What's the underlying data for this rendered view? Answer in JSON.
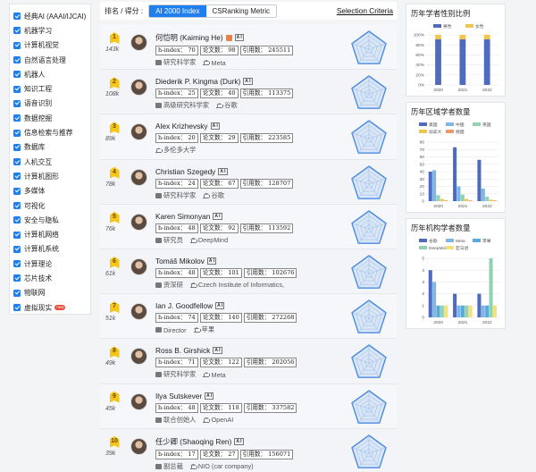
{
  "sidebar": {
    "items": [
      {
        "label": "经典AI (AAAI/IJCAI)"
      },
      {
        "label": "机器学习"
      },
      {
        "label": "计算机视觉"
      },
      {
        "label": "自然语言处理"
      },
      {
        "label": "机器人"
      },
      {
        "label": "知识工程"
      },
      {
        "label": "语音识别"
      },
      {
        "label": "数据挖掘"
      },
      {
        "label": "信息检索与推荐"
      },
      {
        "label": "数据库"
      },
      {
        "label": "人机交互"
      },
      {
        "label": "计算机图形"
      },
      {
        "label": "多媒体"
      },
      {
        "label": "可视化"
      },
      {
        "label": "安全与隐私"
      },
      {
        "label": "计算机网络"
      },
      {
        "label": "计算机系统"
      },
      {
        "label": "计算理论"
      },
      {
        "label": "芯片技术"
      },
      {
        "label": "物联网"
      },
      {
        "label": "虚拟现实",
        "badge": "new"
      }
    ]
  },
  "topbar": {
    "rank_label": "排名 / 得分 :",
    "tabs": [
      "AI 2000 Index",
      "CSRanking Metric"
    ],
    "criteria": "Selection Criteria"
  },
  "scholars": [
    {
      "rank": "1",
      "score": "143k",
      "name": "何恺明 (Kaiming He)",
      "badge_square": true,
      "ai_tag": "A I",
      "hindex": "h-index： 70",
      "papers": "论文数： 98",
      "citations": "引用数： 245511",
      "role": "研究科学家",
      "org": "Meta"
    },
    {
      "rank": "2",
      "score": "108k",
      "name": "Diederik P. Kingma (Durk)",
      "ai_tag": "A I",
      "hindex": "h-index： 25",
      "papers": "论文数： 40",
      "citations": "引用数： 113375",
      "role": "高级研究科学家",
      "org": "谷歌"
    },
    {
      "rank": "3",
      "score": "89k",
      "name": "Alex Krizhevsky",
      "ai_tag": "A I",
      "hindex": "h-index： 20",
      "papers": "论文数： 29",
      "citations": "引用数： 223585",
      "role": "",
      "org": "多伦多大学"
    },
    {
      "rank": "4",
      "score": "78k",
      "name": "Christian Szegedy",
      "ai_tag": "A I",
      "hindex": "h-index： 24",
      "papers": "论文数： 67",
      "citations": "引用数： 128707",
      "role": "研究科学家",
      "org": "谷歌"
    },
    {
      "rank": "5",
      "score": "76k",
      "name": "Karen Simonyan",
      "ai_tag": "A I",
      "hindex": "h-index： 48",
      "papers": "论文数： 92",
      "citations": "引用数： 113592",
      "role": "研究员",
      "org": "DeepMind"
    },
    {
      "rank": "6",
      "score": "61k",
      "name": "Tomáš Mikolov",
      "ai_tag": "A I",
      "hindex": "h-index： 48",
      "papers": "论文数： 101",
      "citations": "引用数： 102676",
      "role": "资深研",
      "org": "Czech Institute of Informatics,"
    },
    {
      "rank": "7",
      "score": "51k",
      "name": "Ian J. Goodfellow",
      "ai_tag": "A I",
      "hindex": "h-index： 74",
      "papers": "论文数： 140",
      "citations": "引用数： 272268",
      "role": "Director",
      "org": "苹果"
    },
    {
      "rank": "8",
      "score": "49k",
      "name": "Ross B. Girshick",
      "ai_tag": "A I",
      "hindex": "h-index： 71",
      "papers": "论文数： 122",
      "citations": "引用数： 202056",
      "role": "研究科学家",
      "org": "Meta"
    },
    {
      "rank": "9",
      "score": "45k",
      "name": "Ilya Sutskever",
      "ai_tag": "A I",
      "hindex": "h-index： 48",
      "papers": "论文数： 118",
      "citations": "引用数： 337582",
      "role": "联合创始人",
      "org": "OpenAI"
    },
    {
      "rank": "10",
      "score": "39k",
      "name": "任少卿 (Shaoqing Ren)",
      "ai_tag": "A I",
      "hindex": "h-index： 17",
      "papers": "论文数： 27",
      "citations": "引用数： 156071",
      "role": "副总裁",
      "org": "NIO (car company)"
    }
  ],
  "chart_data": [
    {
      "type": "bar",
      "title": "历年学者性别比例",
      "categories": [
        "2020",
        "2021",
        "2022"
      ],
      "ylim": [
        0,
        1
      ],
      "ticks": [
        "100%",
        "80%",
        "60%",
        "40%",
        "20%",
        "0%"
      ],
      "series": [
        {
          "name": "男性",
          "color": "#4e6bbf",
          "values": [
            0.91,
            0.91,
            0.91
          ]
        },
        {
          "name": "女性",
          "color": "#f3c64b",
          "values": [
            0.09,
            0.09,
            0.09
          ]
        }
      ]
    },
    {
      "type": "bar",
      "title": "历年区域学者数量",
      "categories": [
        "2020",
        "2021",
        "2022"
      ],
      "ylim": [
        0,
        80
      ],
      "ticks": [
        "80",
        "70",
        "60",
        "50",
        "40",
        "30",
        "20",
        "10",
        "0"
      ],
      "series": [
        {
          "name": "美国",
          "color": "#4e6bbf",
          "values": [
            40,
            73,
            56
          ]
        },
        {
          "name": "中国",
          "color": "#7fb6e6",
          "values": [
            42,
            20,
            17
          ]
        },
        {
          "name": "英国",
          "color": "#8fd3b5",
          "values": [
            8,
            9,
            6
          ]
        },
        {
          "name": "加拿大",
          "color": "#f3c64b",
          "values": [
            3,
            3,
            2
          ]
        },
        {
          "name": "德国",
          "color": "#ea9a6a",
          "values": [
            1,
            1,
            1
          ]
        }
      ]
    },
    {
      "type": "bar",
      "title": "历年机构学者数量",
      "categories": [
        "2020",
        "2021",
        "2022"
      ],
      "ylim": [
        0,
        5
      ],
      "ticks": [
        "5",
        "4",
        "3",
        "2",
        "1",
        "0"
      ],
      "series": [
        {
          "name": "谷歌",
          "color": "#4e6bbf",
          "values": [
            4,
            2,
            2
          ]
        },
        {
          "name": "Meta",
          "color": "#7fb6e6",
          "values": [
            3,
            1,
            1
          ]
        },
        {
          "name": "苹果",
          "color": "#5aa9dc",
          "values": [
            1,
            1,
            1
          ]
        },
        {
          "name": "DeepMind",
          "color": "#8fd3b5",
          "values": [
            1,
            1,
            5
          ]
        },
        {
          "name": "亚马逊",
          "color": "#f3e27a",
          "values": [
            1,
            1,
            1
          ]
        }
      ]
    }
  ]
}
